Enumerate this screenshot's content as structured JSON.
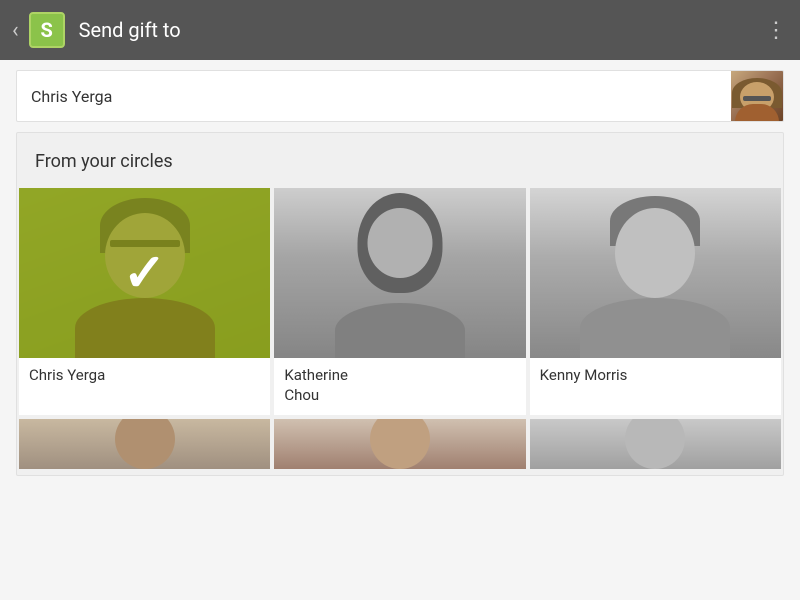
{
  "app": {
    "icon_letter": "S",
    "title": "Send gift to",
    "back_label": "‹",
    "more_label": "⋮"
  },
  "recipient": {
    "name": "Chris Yerga"
  },
  "circles": {
    "section_title": "From your circles",
    "contacts": [
      {
        "id": "chris-yerga",
        "name": "Chris Yerga",
        "selected": true
      },
      {
        "id": "katherine-chou",
        "name": "Katherine\nChou",
        "selected": false
      },
      {
        "id": "kenny-morris",
        "name": "Kenny Morris",
        "selected": false
      }
    ],
    "check_symbol": "✓"
  }
}
